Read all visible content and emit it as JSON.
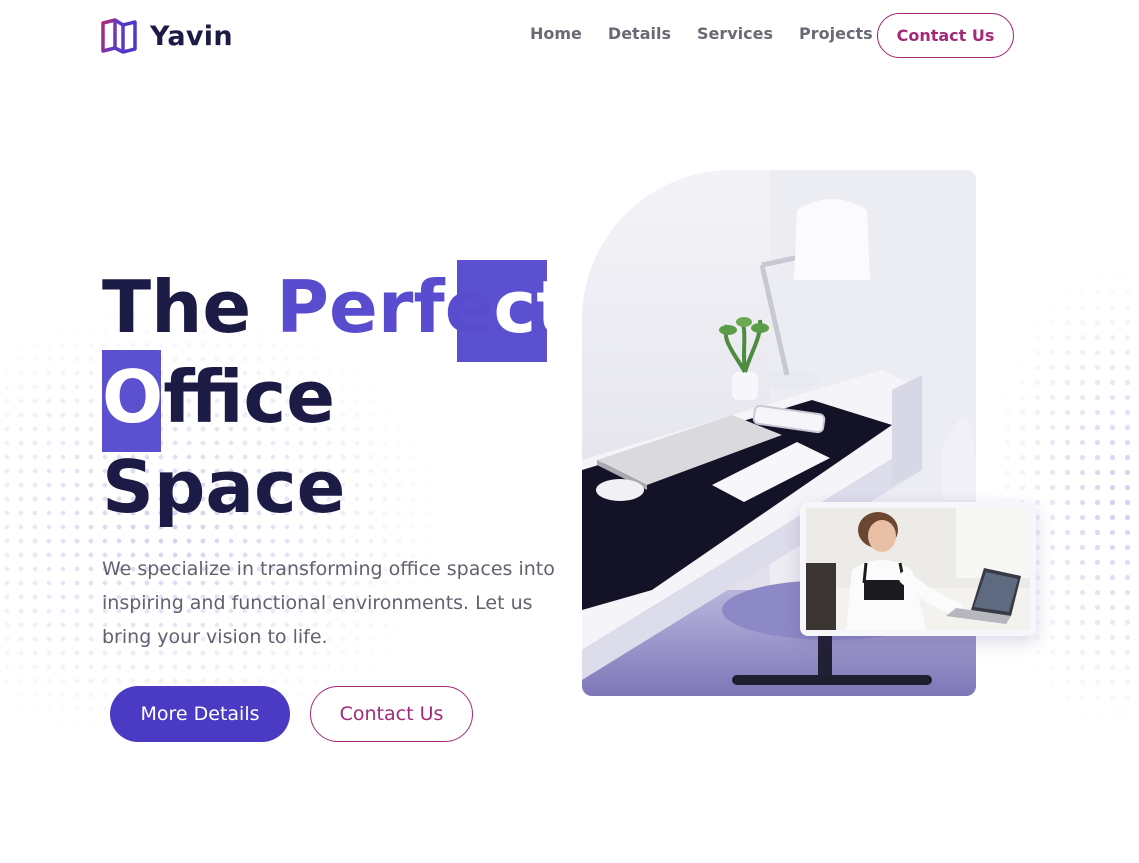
{
  "brand": {
    "name": "Yavin",
    "logo_icon": "book-icon",
    "colors": {
      "primary": "#4b3bc4",
      "accent": "#a32a78",
      "heading": "#1c1b45"
    }
  },
  "nav": {
    "items": [
      {
        "label": "Home"
      },
      {
        "label": "Details"
      },
      {
        "label": "Services"
      },
      {
        "label": "Projects"
      }
    ],
    "cta_label": "Contact Us"
  },
  "hero": {
    "title": {
      "line1_plain": "The ",
      "line1_accent": "Perfe",
      "line1_highlight": "ct",
      "line2_highlight": "O",
      "line2_rest": "ffice",
      "line3": "Space"
    },
    "description": "We specialize in transforming office spaces into inspiring and functional environments. Let us bring your vision to life.",
    "primary_button": "More Details",
    "secondary_button": "Contact Us"
  }
}
